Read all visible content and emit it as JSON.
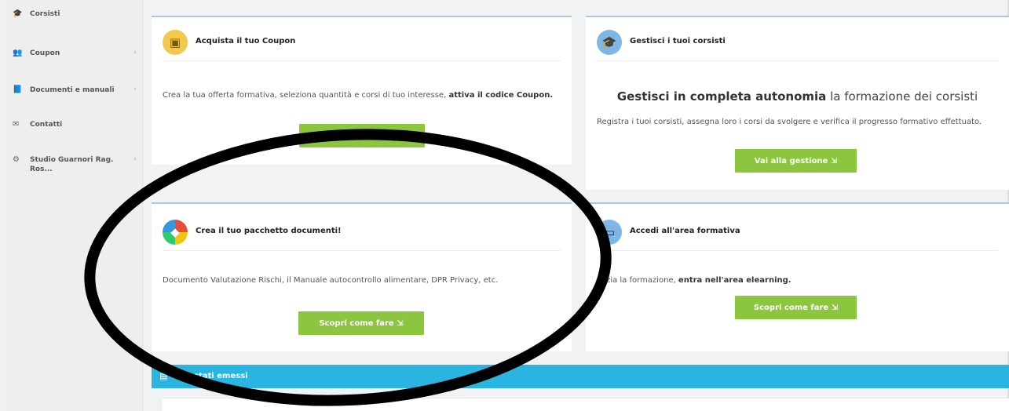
{
  "sidebar": {
    "items": [
      {
        "icon": "graduation-icon",
        "glyph": "🎓",
        "label": "Corsisti"
      },
      {
        "icon": "users-icon",
        "glyph": "👥",
        "label": "Coupon"
      },
      {
        "icon": "book-icon",
        "glyph": "📘",
        "label": "Documenti e manuali"
      },
      {
        "icon": "envelope-icon",
        "glyph": "✉",
        "label": "Contatti"
      },
      {
        "icon": "gear-icon",
        "glyph": "⚙",
        "label": "Studio Guarnori Rag. Ros..."
      }
    ]
  },
  "cards": {
    "coupon": {
      "title": "Acquista il tuo Coupon",
      "text_plain": "Crea la tua offerta formativa, seleziona quantità e corsi di tuo interesse, ",
      "text_bold": "attiva il codice Coupon.",
      "button": "Scopri come fare ⇲"
    },
    "corsisti": {
      "title": "Gestisci i tuoi corsisti",
      "headline_bold": "Gestisci in completa autonomia",
      "headline_rest": " la formazione dei corsisti",
      "text": "Registra i tuoi corsisti, assegna loro i corsi da svolgere e verifica il progresso formativo effettuato.",
      "button": "Vai alla gestione ⇲"
    },
    "documenti": {
      "title": "Crea il tuo pacchetto documenti!",
      "text": "Documento Valutazione Rischi, il Manuale autocontrollo alimentare, DPR Privacy, etc.",
      "button": "Scopri come fare ⇲"
    },
    "formazione": {
      "title": "Accedi all'area formativa",
      "text_plain": "Inizia la formazione, ",
      "text_bold": "entra nell'area elearning.",
      "button": "Scopri come fare ⇲"
    }
  },
  "banner": {
    "title": "Attestati emessi"
  },
  "colors": {
    "button_green": "#8cc63f",
    "banner_blue": "#2ab5e0",
    "card_border": "#a9c8de"
  }
}
